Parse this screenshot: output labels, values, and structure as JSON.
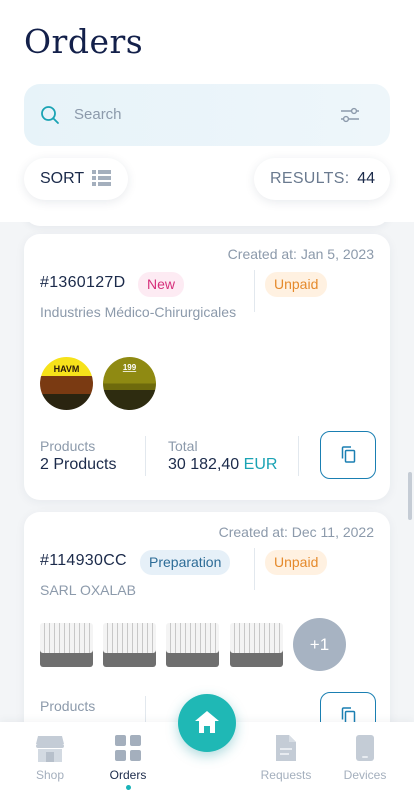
{
  "page": {
    "title": "Orders"
  },
  "search": {
    "placeholder": "Search",
    "icon": "search-icon",
    "filter_icon": "filter-sliders-icon"
  },
  "sort": {
    "label": "SORT",
    "icon": "list-icon"
  },
  "results": {
    "label": "RESULTS:",
    "count": "44"
  },
  "orders": [
    {
      "created": "Created at: Jan 5, 2023",
      "id": "#1360127D",
      "status": "New",
      "payment": "Unpaid",
      "company": "Industries Médico-Chirurgicales",
      "thumbnails": [
        "HAVM",
        "199"
      ],
      "products_label": "Products",
      "products_value": "2 Products",
      "total_label": "Total",
      "total_amount": "30 182,40",
      "currency": "EUR"
    },
    {
      "created": "Created at: Dec 11, 2022",
      "id": "#114930CC",
      "status": "Preparation",
      "payment": "Unpaid",
      "company": "SARL OXALAB",
      "more_count": "+1",
      "products_label": "Products"
    }
  ],
  "colors": {
    "accent": "#1fb8b5",
    "new": "#d6307b",
    "preparation": "#2d6c97",
    "unpaid": "#e58a2c",
    "currency": "#1aa3b4"
  },
  "nav": {
    "shop": "Shop",
    "orders": "Orders",
    "requests": "Requests",
    "devices": "Devices",
    "home_icon": "home-icon"
  }
}
